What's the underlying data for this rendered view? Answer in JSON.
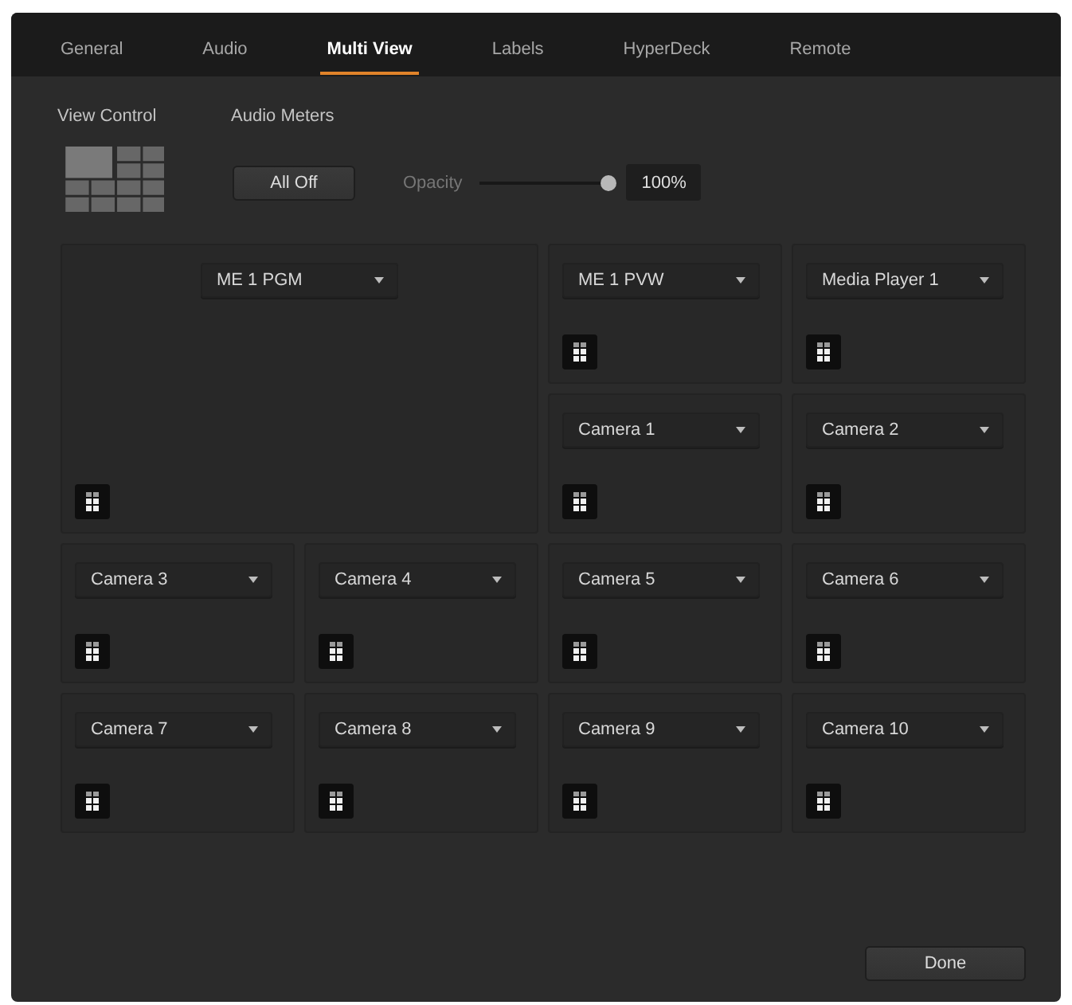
{
  "tabs": [
    {
      "label": "General",
      "selected": false
    },
    {
      "label": "Audio",
      "selected": false
    },
    {
      "label": "Multi View",
      "selected": true
    },
    {
      "label": "Labels",
      "selected": false
    },
    {
      "label": "HyperDeck",
      "selected": false
    },
    {
      "label": "Remote",
      "selected": false
    }
  ],
  "view_control": {
    "label": "View Control"
  },
  "audio_meters": {
    "label": "Audio Meters",
    "all_off_button": "All Off",
    "opacity": {
      "label": "Opacity",
      "level": 1,
      "value": "100%"
    }
  },
  "views": [
    {
      "kind": "large",
      "source": "ME 1 PGM"
    },
    {
      "kind": "small",
      "source": "ME 1 PVW"
    },
    {
      "kind": "small",
      "source": "Media Player 1"
    },
    {
      "kind": "small",
      "source": "Camera 1"
    },
    {
      "kind": "small",
      "source": "Camera 2"
    },
    {
      "kind": "small",
      "source": "Camera 3"
    },
    {
      "kind": "small",
      "source": "Camera 4"
    },
    {
      "kind": "small",
      "source": "Camera 5"
    },
    {
      "kind": "small",
      "source": "Camera 6"
    },
    {
      "kind": "small",
      "source": "Camera 7"
    },
    {
      "kind": "small",
      "source": "Camera 8"
    },
    {
      "kind": "small",
      "source": "Camera 9"
    },
    {
      "kind": "small",
      "source": "Camera 10"
    }
  ],
  "buttons": [
    "Done"
  ]
}
